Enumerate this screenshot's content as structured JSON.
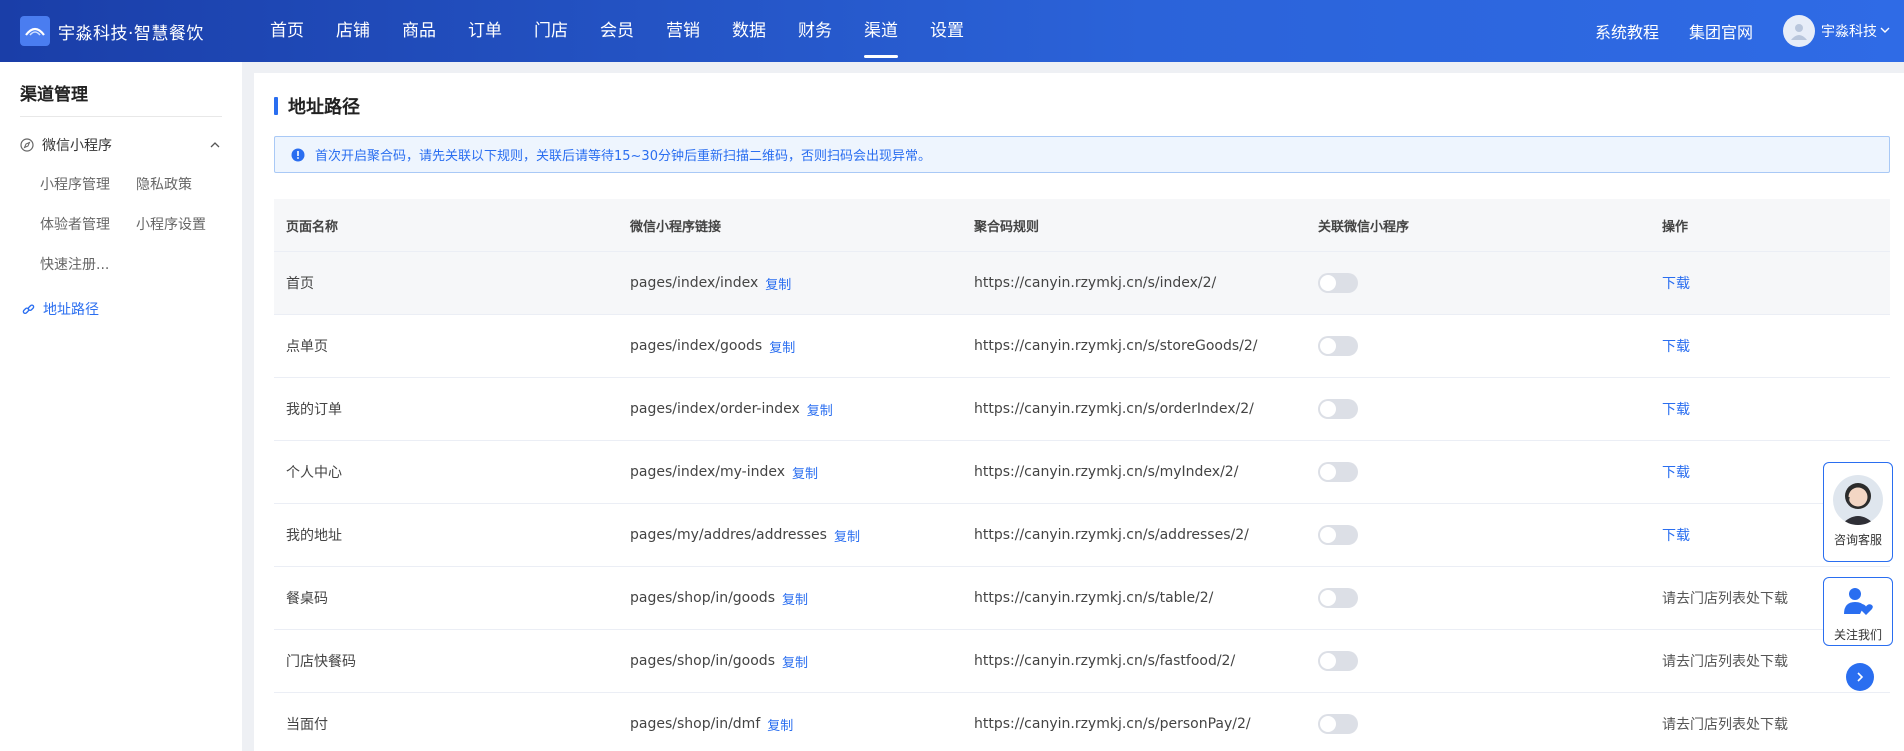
{
  "brand": {
    "title": "宇淼科技·智慧餐饮"
  },
  "nav": {
    "items": [
      {
        "label": "首页"
      },
      {
        "label": "店铺"
      },
      {
        "label": "商品"
      },
      {
        "label": "订单"
      },
      {
        "label": "门店"
      },
      {
        "label": "会员"
      },
      {
        "label": "营销"
      },
      {
        "label": "数据"
      },
      {
        "label": "财务"
      },
      {
        "label": "渠道",
        "active": true
      },
      {
        "label": "设置"
      }
    ]
  },
  "header_right": {
    "tutorial": "系统教程",
    "official_site": "集团官网",
    "user_name": "宇淼科技"
  },
  "sidebar": {
    "title": "渠道管理",
    "group": {
      "label": "微信小程序",
      "items": [
        "小程序管理",
        "隐私政策",
        "体验者管理",
        "小程序设置",
        "快速注册..."
      ]
    },
    "active_link": "地址路径"
  },
  "main": {
    "title": "地址路径",
    "alert": "首次开启聚合码，请先关联以下规则，关联后请等待15~30分钟后重新扫描二维码，否则扫码会出现异常。",
    "columns": [
      "页面名称",
      "微信小程序链接",
      "聚合码规则",
      "关联微信小程序",
      "操作"
    ],
    "copy_label": "复制",
    "rows": [
      {
        "name": "首页",
        "path": "pages/index/index",
        "rule": "https://canyin.rzymkj.cn/s/index/2/",
        "linked": false,
        "action": "下载",
        "action_is_link": true
      },
      {
        "name": "点单页",
        "path": "pages/index/goods",
        "rule": "https://canyin.rzymkj.cn/s/storeGoods/2/",
        "linked": false,
        "action": "下载",
        "action_is_link": true
      },
      {
        "name": "我的订单",
        "path": "pages/index/order-index",
        "rule": "https://canyin.rzymkj.cn/s/orderIndex/2/",
        "linked": false,
        "action": "下载",
        "action_is_link": true
      },
      {
        "name": "个人中心",
        "path": "pages/index/my-index",
        "rule": "https://canyin.rzymkj.cn/s/myIndex/2/",
        "linked": false,
        "action": "下载",
        "action_is_link": true
      },
      {
        "name": "我的地址",
        "path": "pages/my/addres/addresses",
        "rule": "https://canyin.rzymkj.cn/s/addresses/2/",
        "linked": false,
        "action": "下载",
        "action_is_link": true
      },
      {
        "name": "餐桌码",
        "path": "pages/shop/in/goods",
        "rule": "https://canyin.rzymkj.cn/s/table/2/",
        "linked": false,
        "action": "请去门店列表处下载",
        "action_is_link": false
      },
      {
        "name": "门店快餐码",
        "path": "pages/shop/in/goods",
        "rule": "https://canyin.rzymkj.cn/s/fastfood/2/",
        "linked": false,
        "action": "请去门店列表处下载",
        "action_is_link": false
      },
      {
        "name": "当面付",
        "path": "pages/shop/in/dmf",
        "rule": "https://canyin.rzymkj.cn/s/personPay/2/",
        "linked": false,
        "action": "请去门店列表处下载",
        "action_is_link": false
      }
    ]
  },
  "floating": {
    "service_label": "咨询客服",
    "follow_label": "关注我们"
  },
  "colors": {
    "primary": "#2a6ef0",
    "nav_gradient_start": "#1a3ea8",
    "nav_gradient_end": "#2f6be6"
  }
}
